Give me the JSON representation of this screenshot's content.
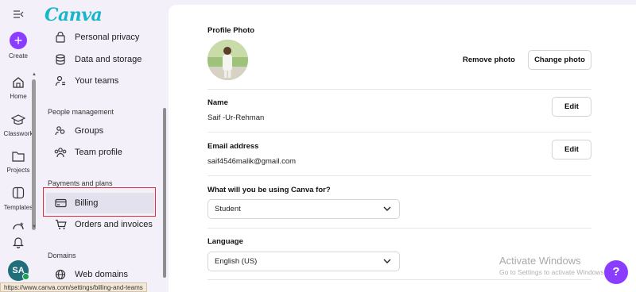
{
  "rail": {
    "create_label": "Create",
    "items": [
      {
        "label": "Home",
        "icon": "home-icon"
      },
      {
        "label": "Classwork",
        "icon": "graduation-cap-icon"
      },
      {
        "label": "Projects",
        "icon": "folder-icon"
      },
      {
        "label": "Templates",
        "icon": "templates-icon"
      }
    ],
    "avatar_initials": "SA"
  },
  "brand": {
    "logo_text": "Canva"
  },
  "nav": {
    "items_top": [
      {
        "label": "Personal privacy",
        "icon": "privacy-icon"
      },
      {
        "label": "Data and storage",
        "icon": "database-icon"
      },
      {
        "label": "Your teams",
        "icon": "teams-icon"
      }
    ],
    "sections": [
      {
        "title": "People management",
        "items": [
          {
            "label": "Groups",
            "icon": "groups-icon"
          },
          {
            "label": "Team profile",
            "icon": "team-profile-icon"
          }
        ]
      },
      {
        "title": "Payments and plans",
        "items": [
          {
            "label": "Billing",
            "icon": "credit-card-icon",
            "active": true
          },
          {
            "label": "Orders and invoices",
            "icon": "cart-icon"
          }
        ]
      },
      {
        "title": "Domains",
        "items": [
          {
            "label": "Web domains",
            "icon": "globe-icon"
          }
        ]
      }
    ]
  },
  "status_url": "https://www.canva.com/settings/billing-and-teams",
  "main": {
    "profile_photo": {
      "title": "Profile Photo",
      "remove_label": "Remove photo",
      "change_label": "Change photo"
    },
    "name": {
      "title": "Name",
      "value": "Saif -Ur-Rehman",
      "edit_label": "Edit"
    },
    "email": {
      "title": "Email address",
      "value": "saif4546malik@gmail.com",
      "edit_label": "Edit"
    },
    "usage": {
      "title": "What will you be using Canva for?",
      "selected": "Student"
    },
    "language": {
      "title": "Language",
      "selected": "English (US)"
    }
  },
  "watermark": {
    "title": "Activate Windows",
    "subtitle": "Go to Settings to activate Windows."
  },
  "help_fab": {
    "label": "?"
  },
  "colors": {
    "brand_purple": "#8b3dff",
    "logo_teal": "#18b6c9",
    "highlight_red": "#e0303b"
  }
}
